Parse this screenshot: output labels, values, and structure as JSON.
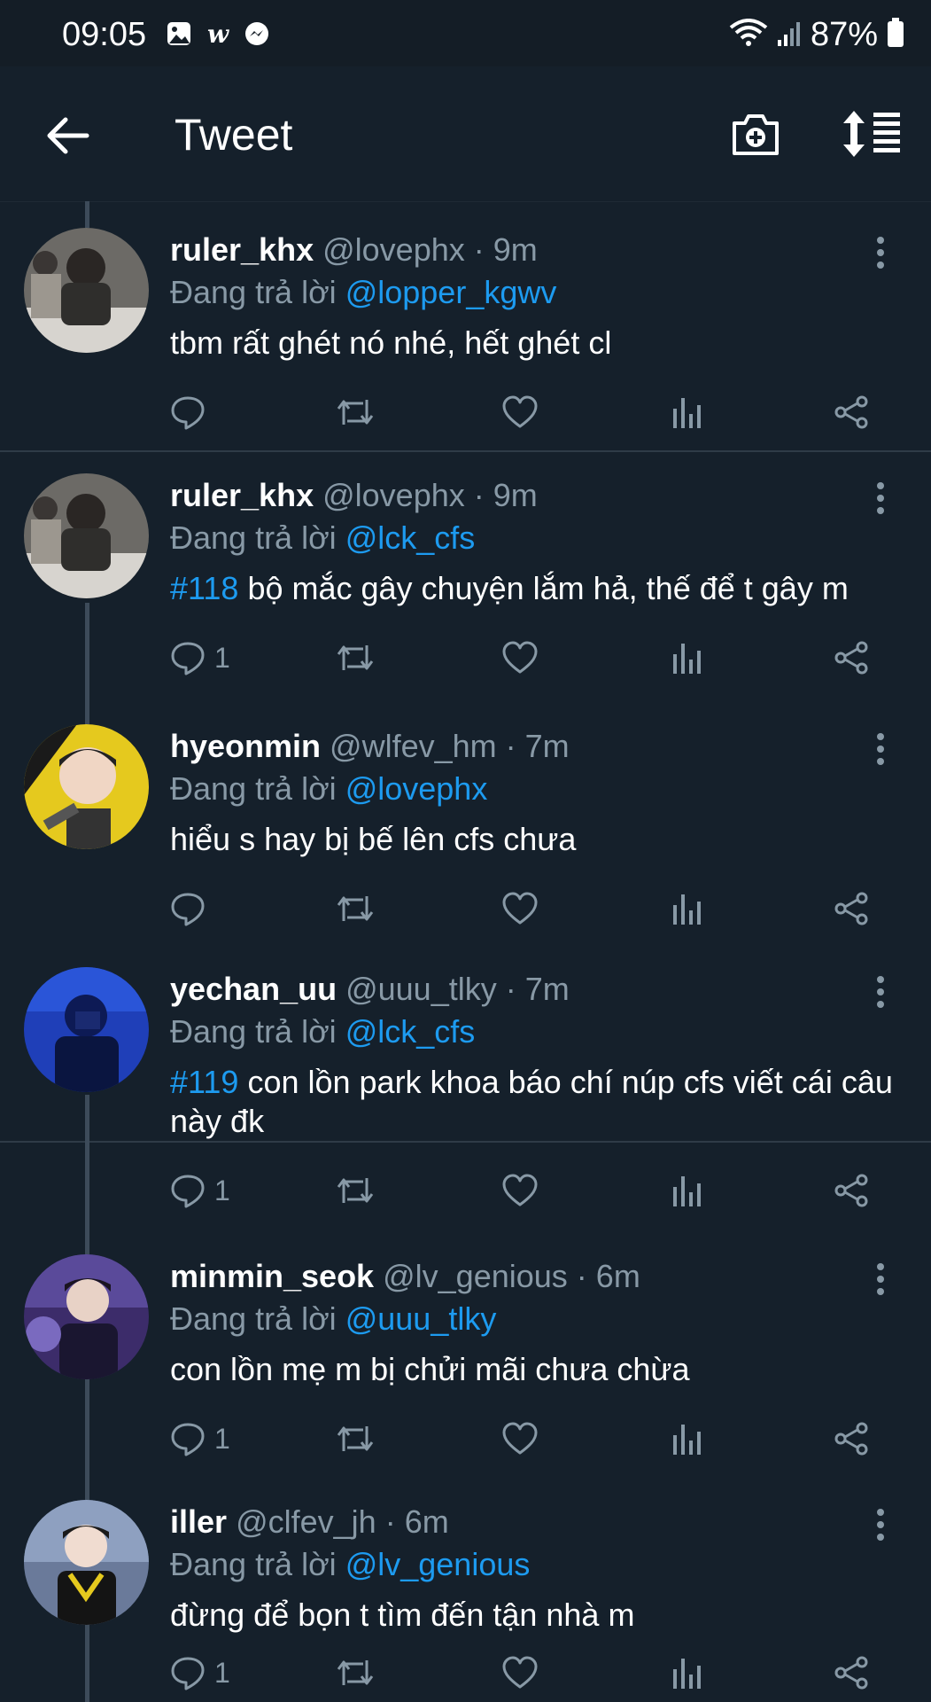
{
  "status_bar": {
    "time": "09:05",
    "battery": "87%",
    "left_icons": [
      "gallery-icon",
      "w-app-icon",
      "messenger-icon"
    ],
    "right_icons": [
      "wifi-icon",
      "signal-icon",
      "battery-icon"
    ]
  },
  "header": {
    "title": "Tweet",
    "back_icon": "arrow-left-icon",
    "camera_icon": "camera-add-icon",
    "sort_icon": "sort-icon"
  },
  "reply_prefix": "Đang trả lời",
  "tweets": [
    {
      "name": "ruler_khx",
      "handle": "@lovephx",
      "time": "9m",
      "reply_to": "@lopper_kgwv",
      "hashtag": "",
      "text": "tbm rất ghét nó nhé, hết ghét cl",
      "reply_count": ""
    },
    {
      "name": "ruler_khx",
      "handle": "@lovephx",
      "time": "9m",
      "reply_to": "@lck_cfs",
      "hashtag": "#118",
      "text": "bộ mắc gây chuyện lắm hả, thế để t gây m",
      "reply_count": "1"
    },
    {
      "name": "hyeonmin",
      "handle": "@wlfev_hm",
      "time": "7m",
      "reply_to": "@lovephx",
      "hashtag": "",
      "text": "hiểu s hay bị bế lên cfs chưa",
      "reply_count": ""
    },
    {
      "name": "yechan_uu",
      "handle": "@uuu_tlky",
      "time": "7m",
      "reply_to": "@lck_cfs",
      "hashtag": "#119",
      "text": "con lồn park khoa báo chí núp cfs viết cái câu này đk",
      "reply_count": "1"
    },
    {
      "name": "minmin_seok",
      "handle": "@lv_genious",
      "time": "6m",
      "reply_to": "@uuu_tlky",
      "hashtag": "",
      "text": "con lồn mẹ m bị chửi mãi chưa chừa",
      "reply_count": "1"
    },
    {
      "name": "iller",
      "handle": "@clfev_jh",
      "time": "6m",
      "reply_to": "@lv_genious",
      "hashtag": "",
      "text": "đừng để bọn t tìm đến tận nhà m",
      "reply_count": "1"
    }
  ],
  "colors": {
    "background": "#15202b",
    "accent": "#1d9bf0",
    "muted": "#8899a6"
  }
}
